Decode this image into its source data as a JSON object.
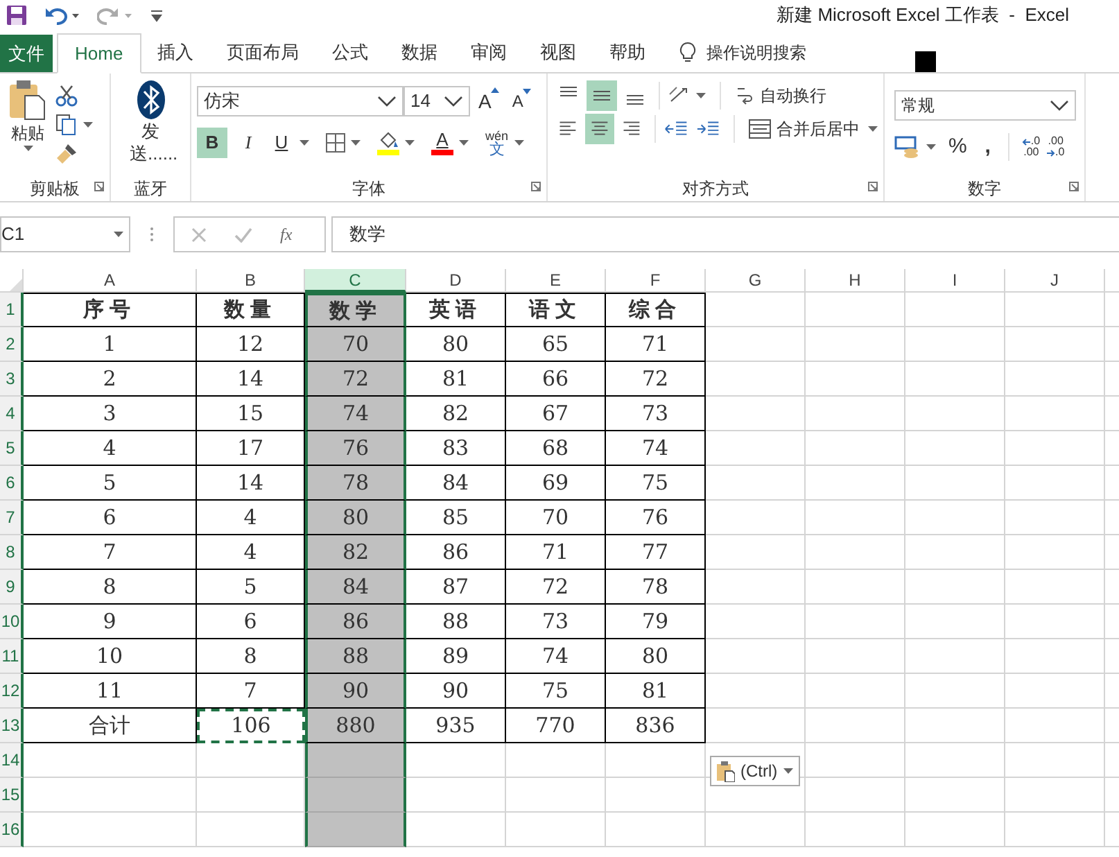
{
  "window": {
    "title": "新建 Microsoft Excel 工作表  -  Excel"
  },
  "tabs": [
    {
      "label": "文件",
      "kind": "file",
      "selected": false
    },
    {
      "label": "Home",
      "kind": "tab",
      "selected": true
    },
    {
      "label": "插入",
      "kind": "tab",
      "selected": false
    },
    {
      "label": "页面布局",
      "kind": "tab",
      "selected": false
    },
    {
      "label": "公式",
      "kind": "tab",
      "selected": false
    },
    {
      "label": "数据",
      "kind": "tab",
      "selected": false
    },
    {
      "label": "审阅",
      "kind": "tab",
      "selected": false
    },
    {
      "label": "视图",
      "kind": "tab",
      "selected": false
    },
    {
      "label": "帮助",
      "kind": "tab",
      "selected": false
    }
  ],
  "tell_me": "操作说明搜索",
  "ribbon": {
    "clipboard": {
      "paste": "粘贴",
      "label": "剪贴板"
    },
    "bluetooth": {
      "send": "发送......",
      "label": "蓝牙"
    },
    "font": {
      "name": "仿宋",
      "size": "14",
      "grow": "A",
      "shrink": "A",
      "bold": {
        "label": "B",
        "selected": true
      },
      "italic": {
        "label": "I",
        "selected": false
      },
      "underline": {
        "label": "U",
        "selected": false
      },
      "font_color": "A",
      "phonetic": [
        "wén",
        "文"
      ],
      "label": "字体"
    },
    "alignment": {
      "top": false,
      "middle": true,
      "bottom": false,
      "left": false,
      "center": true,
      "right": false,
      "wrap": "自动换行",
      "merge": "合并后居中",
      "label": "对齐方式"
    },
    "number": {
      "format": "常规",
      "percent": "%",
      "comma": ",",
      "decrease_decimal": [
        ".0",
        ".00"
      ],
      "increase_decimal": [
        ".00",
        ".0"
      ],
      "label": "数字"
    }
  },
  "formula_bar": {
    "name_box": "C1",
    "fx": "fx",
    "value": "数学"
  },
  "columns": [
    {
      "label": "A",
      "selected": false
    },
    {
      "label": "B",
      "selected": false
    },
    {
      "label": "C",
      "selected": true
    },
    {
      "label": "D",
      "selected": false
    },
    {
      "label": "E",
      "selected": false
    },
    {
      "label": "F",
      "selected": false
    },
    {
      "label": "G",
      "selected": false
    },
    {
      "label": "H",
      "selected": false
    },
    {
      "label": "I",
      "selected": false
    },
    {
      "label": "J",
      "selected": false
    }
  ],
  "rows": [
    {
      "header": "1",
      "cells": [
        "序号",
        "数量",
        "数学",
        "英语",
        "语文",
        "综合"
      ],
      "copied": [
        false,
        false,
        false,
        false,
        false,
        false
      ]
    },
    {
      "header": "2",
      "cells": [
        "1",
        "12",
        "70",
        "80",
        "65",
        "71"
      ],
      "copied": [
        false,
        false,
        false,
        false,
        false,
        false
      ]
    },
    {
      "header": "3",
      "cells": [
        "2",
        "14",
        "72",
        "81",
        "66",
        "72"
      ],
      "copied": [
        false,
        false,
        false,
        false,
        false,
        false
      ]
    },
    {
      "header": "4",
      "cells": [
        "3",
        "15",
        "74",
        "82",
        "67",
        "73"
      ],
      "copied": [
        false,
        false,
        false,
        false,
        false,
        false
      ]
    },
    {
      "header": "5",
      "cells": [
        "4",
        "17",
        "76",
        "83",
        "68",
        "74"
      ],
      "copied": [
        false,
        false,
        false,
        false,
        false,
        false
      ]
    },
    {
      "header": "6",
      "cells": [
        "5",
        "14",
        "78",
        "84",
        "69",
        "75"
      ],
      "copied": [
        false,
        false,
        false,
        false,
        false,
        false
      ]
    },
    {
      "header": "7",
      "cells": [
        "6",
        "4",
        "80",
        "85",
        "70",
        "76"
      ],
      "copied": [
        false,
        false,
        false,
        false,
        false,
        false
      ]
    },
    {
      "header": "8",
      "cells": [
        "7",
        "4",
        "82",
        "86",
        "71",
        "77"
      ],
      "copied": [
        false,
        false,
        false,
        false,
        false,
        false
      ]
    },
    {
      "header": "9",
      "cells": [
        "8",
        "5",
        "84",
        "87",
        "72",
        "78"
      ],
      "copied": [
        false,
        false,
        false,
        false,
        false,
        false
      ]
    },
    {
      "header": "10",
      "cells": [
        "9",
        "6",
        "86",
        "88",
        "73",
        "79"
      ],
      "copied": [
        false,
        false,
        false,
        false,
        false,
        false
      ]
    },
    {
      "header": "11",
      "cells": [
        "10",
        "8",
        "88",
        "89",
        "74",
        "80"
      ],
      "copied": [
        false,
        false,
        false,
        false,
        false,
        false
      ]
    },
    {
      "header": "12",
      "cells": [
        "11",
        "7",
        "90",
        "90",
        "75",
        "81"
      ],
      "copied": [
        false,
        false,
        false,
        false,
        false,
        false
      ]
    },
    {
      "header": "13",
      "cells": [
        "合计",
        "106",
        "880",
        "935",
        "770",
        "836"
      ],
      "copied": [
        false,
        true,
        false,
        false,
        false,
        false
      ]
    },
    {
      "header": "14",
      "cells": []
    },
    {
      "header": "15",
      "cells": []
    },
    {
      "header": "16",
      "cells": []
    }
  ],
  "paste_options": "(Ctrl)"
}
